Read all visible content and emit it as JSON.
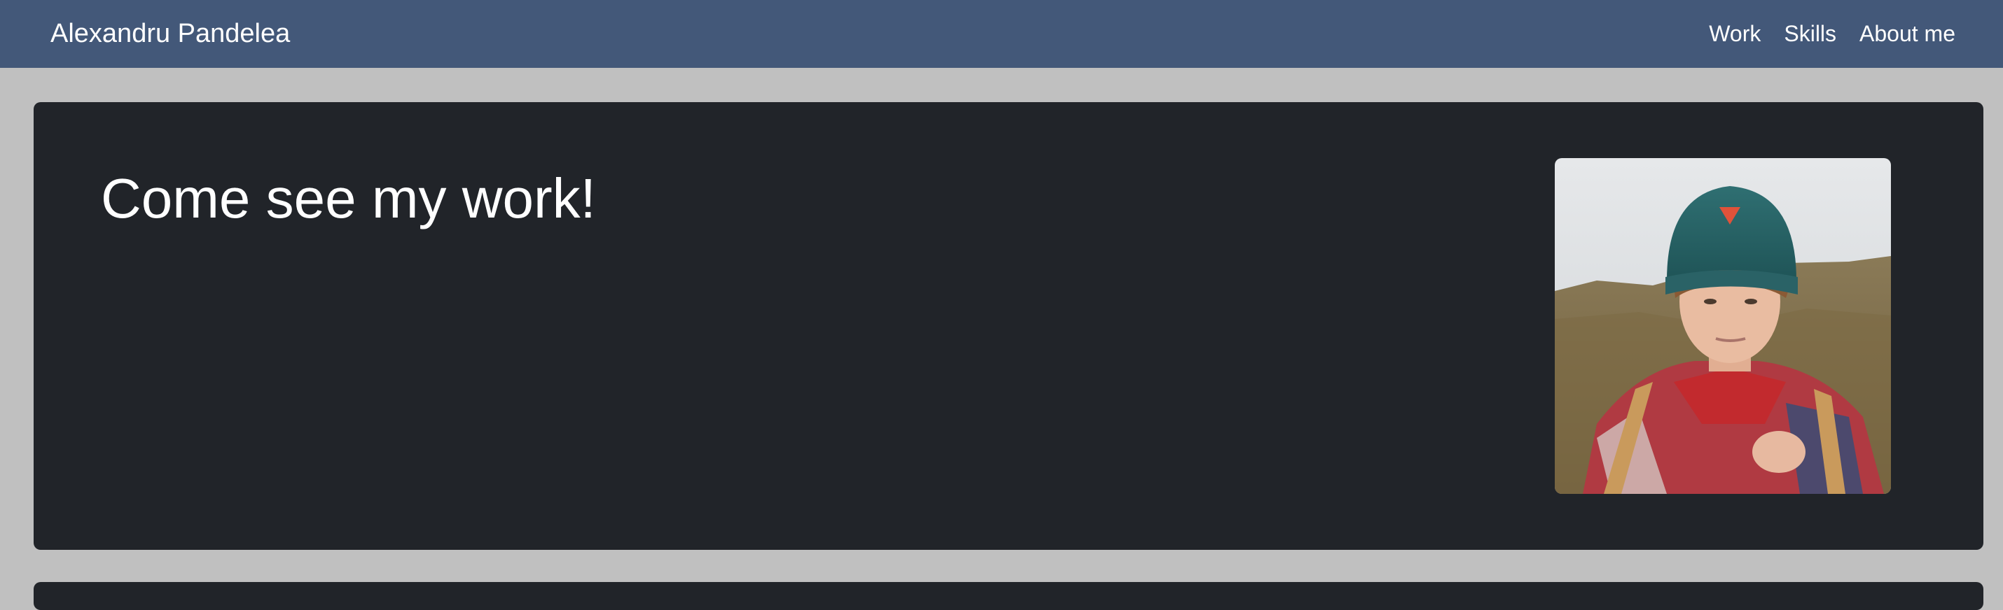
{
  "navbar": {
    "brand": "Alexandru Pandelea",
    "links": [
      {
        "label": "Work"
      },
      {
        "label": "Skills"
      },
      {
        "label": "About me"
      }
    ],
    "background_color": "#435879"
  },
  "hero": {
    "title": "Come see my work!",
    "background_color": "#212429"
  },
  "page": {
    "background_color": "#c0c0c0"
  }
}
